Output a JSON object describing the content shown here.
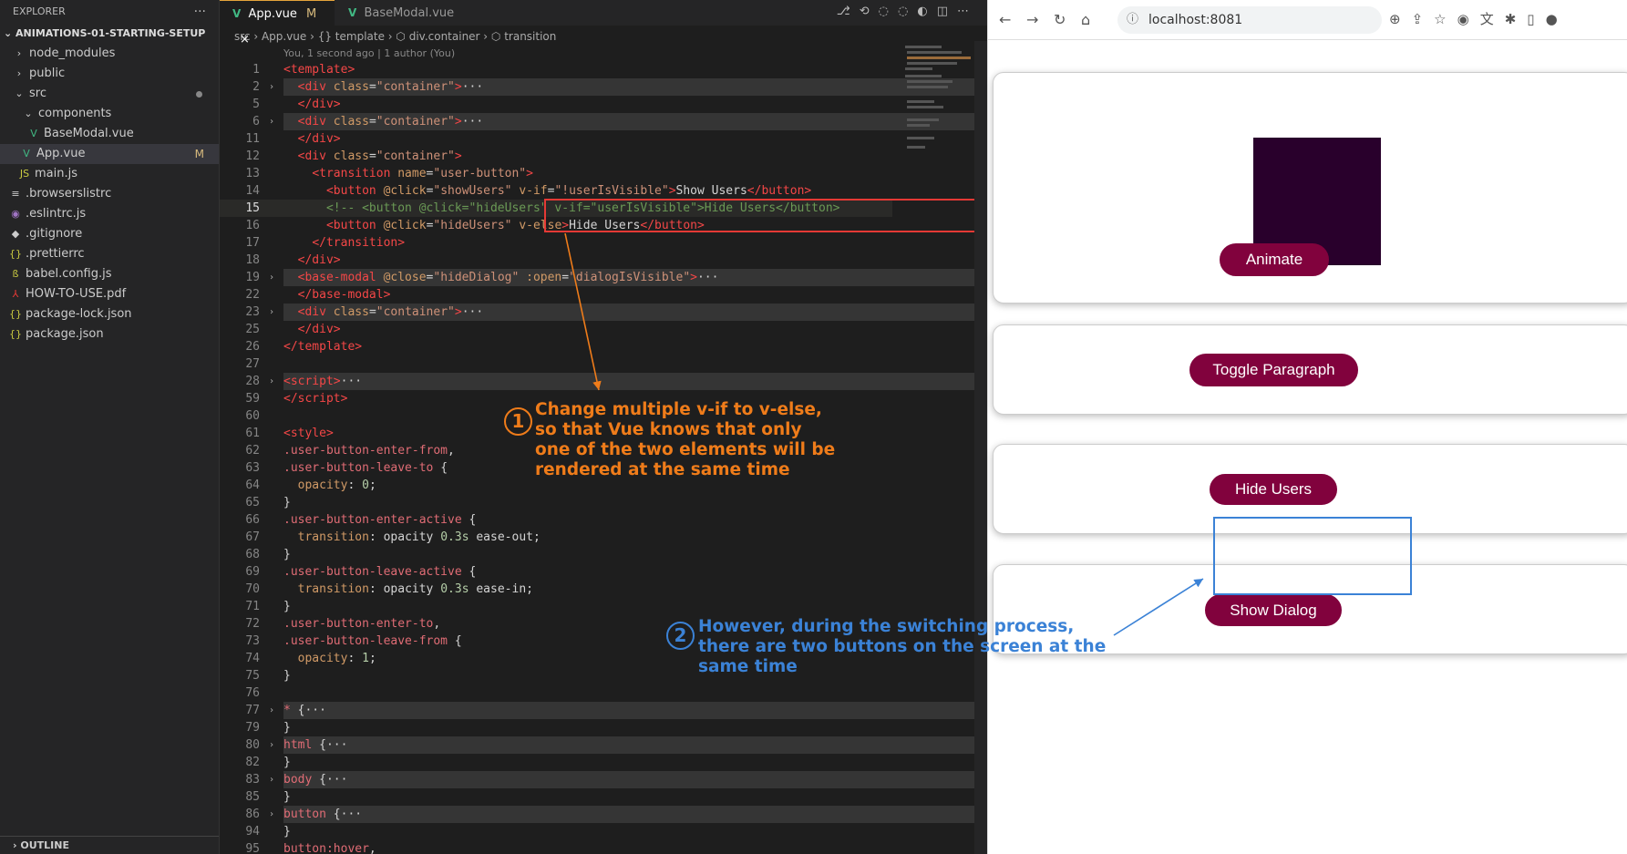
{
  "explorer": {
    "title": "EXPLORER",
    "more": "···",
    "project": "ANIMATIONS-01-STARTING-SETUP",
    "items": [
      {
        "label": "node_modules",
        "icon": "›",
        "indent": 14
      },
      {
        "label": "public",
        "icon": "›",
        "indent": 14
      },
      {
        "label": "src",
        "icon": "⌄",
        "indent": 14
      },
      {
        "label": "components",
        "icon": "⌄",
        "indent": 24
      },
      {
        "label": "BaseModal.vue",
        "icon": "V",
        "indent": 30
      },
      {
        "label": "App.vue",
        "icon": "V",
        "indent": 22,
        "badge": "M"
      },
      {
        "label": "main.js",
        "icon": "JS",
        "indent": 20
      },
      {
        "label": ".browserslistrc",
        "icon": "≡",
        "indent": 10
      },
      {
        "label": ".eslintrc.js",
        "icon": "◉",
        "indent": 10
      },
      {
        "label": ".gitignore",
        "icon": "◆",
        "indent": 10
      },
      {
        "label": ".prettierrc",
        "icon": "{}",
        "indent": 10
      },
      {
        "label": "babel.config.js",
        "icon": "ß",
        "indent": 10
      },
      {
        "label": "HOW-TO-USE.pdf",
        "icon": "⅄",
        "indent": 10
      },
      {
        "label": "package-lock.json",
        "icon": "{}",
        "indent": 10
      },
      {
        "label": "package.json",
        "icon": "{}",
        "indent": 10
      }
    ],
    "outline": "OUTLINE"
  },
  "editor": {
    "tabs": [
      {
        "label": "App.vue",
        "badge": "M",
        "close": "×"
      },
      {
        "label": "BaseModal.vue"
      }
    ],
    "breadcrumb": "src  ›  App.vue  ›  {} template  ›  ⬡ div.container  ›  ⬡ transition",
    "blame": "You, 1 second ago | 1 author (You)",
    "lines": [
      {
        "n": "1",
        "html": "<span class='tg'>&lt;template&gt;</span>"
      },
      {
        "n": "2",
        "fold": true,
        "folded": true,
        "html": "  <span class='tg'>&lt;div</span> <span class='at'>class</span>=<span class='st'>\"container\"</span><span class='tg'>&gt;</span>···"
      },
      {
        "n": "5",
        "html": "  <span class='tg'>&lt;/div&gt;</span>"
      },
      {
        "n": "6",
        "fold": true,
        "folded": true,
        "html": "  <span class='tg'>&lt;div</span> <span class='at'>class</span>=<span class='st'>\"container\"</span><span class='tg'>&gt;</span>···"
      },
      {
        "n": "11",
        "html": "  <span class='tg'>&lt;/div&gt;</span>"
      },
      {
        "n": "12",
        "html": "  <span class='tg'>&lt;div</span> <span class='at'>class</span>=<span class='st'>\"container\"</span><span class='tg'>&gt;</span>"
      },
      {
        "n": "13",
        "html": "    <span class='tg'>&lt;transition</span> <span class='at'>name</span>=<span class='st'>\"user-button\"</span><span class='tg'>&gt;</span>"
      },
      {
        "n": "14",
        "html": "      <span class='tg'>&lt;button</span> <span class='at'>@click</span>=<span class='st'>\"showUsers\"</span> <span class='at'>v-if</span>=<span class='st'>\"!userIsVisible\"</span><span class='tg'>&gt;</span>Show Users<span class='tg'>&lt;/button&gt;</span>"
      },
      {
        "n": "15",
        "cur": true,
        "html": "      <span class='cm'>&lt;!-- &lt;button @click=\"hideUsers\" v-if=\"userIsVisible\"&gt;Hide Users&lt;/button&gt;</span>"
      },
      {
        "n": "16",
        "html": "      <span class='tg'>&lt;button</span> <span class='at'>@click</span>=<span class='st'>\"hideUsers\"</span> <span class='at'>v-else</span><span class='tg'>&gt;</span>Hide Users<span class='tg'>&lt;/button&gt;</span>"
      },
      {
        "n": "17",
        "html": "    <span class='tg'>&lt;/transition&gt;</span>"
      },
      {
        "n": "18",
        "html": "  <span class='tg'>&lt;/div&gt;</span>"
      },
      {
        "n": "19",
        "fold": true,
        "folded": true,
        "html": "  <span class='tg'>&lt;base-modal</span> <span class='at'>@close</span>=<span class='st'>\"hideDialog\"</span> <span class='at'>:open</span>=<span class='st'>\"dialogIsVisible\"</span><span class='tg'>&gt;</span>···"
      },
      {
        "n": "22",
        "html": "  <span class='tg'>&lt;/base-modal&gt;</span>"
      },
      {
        "n": "23",
        "fold": true,
        "folded": true,
        "html": "  <span class='tg'>&lt;div</span> <span class='at'>class</span>=<span class='st'>\"container\"</span><span class='tg'>&gt;</span>···"
      },
      {
        "n": "25",
        "html": "  <span class='tg'>&lt;/div&gt;</span>"
      },
      {
        "n": "26",
        "html": "<span class='tg'>&lt;/template&gt;</span>"
      },
      {
        "n": "27",
        "html": ""
      },
      {
        "n": "28",
        "fold": true,
        "folded": true,
        "html": "<span class='tg'>&lt;script&gt;</span>···"
      },
      {
        "n": "59",
        "html": "<span class='tg'>&lt;/script&gt;</span>"
      },
      {
        "n": "60",
        "html": ""
      },
      {
        "n": "61",
        "html": "<span class='tg'>&lt;style&gt;</span>"
      },
      {
        "n": "62",
        "html": "<span class='sel'>.user-button-enter-from</span>,"
      },
      {
        "n": "63",
        "html": "<span class='sel'>.user-button-leave-to</span> {"
      },
      {
        "n": "64",
        "html": "  <span class='at'>opacity</span>: <span class='num'>0</span>;"
      },
      {
        "n": "65",
        "html": "}"
      },
      {
        "n": "66",
        "html": "<span class='sel'>.user-button-enter-active</span> {"
      },
      {
        "n": "67",
        "html": "  <span class='at'>transition</span>: opacity <span class='num'>0.3s</span> ease-out;"
      },
      {
        "n": "68",
        "html": "}"
      },
      {
        "n": "69",
        "html": "<span class='sel'>.user-button-leave-active</span> {"
      },
      {
        "n": "70",
        "html": "  <span class='at'>transition</span>: opacity <span class='num'>0.3s</span> ease-in;"
      },
      {
        "n": "71",
        "html": "}"
      },
      {
        "n": "72",
        "html": "<span class='sel'>.user-button-enter-to</span>,"
      },
      {
        "n": "73",
        "html": "<span class='sel'>.user-button-leave-from</span> {"
      },
      {
        "n": "74",
        "html": "  <span class='at'>opacity</span>: <span class='num'>1</span>;"
      },
      {
        "n": "75",
        "html": "}"
      },
      {
        "n": "76",
        "html": ""
      },
      {
        "n": "77",
        "fold": true,
        "folded": true,
        "html": "<span class='sel'>*</span> {···"
      },
      {
        "n": "79",
        "html": "}"
      },
      {
        "n": "80",
        "fold": true,
        "folded": true,
        "html": "<span class='sel'>html</span> {···"
      },
      {
        "n": "82",
        "html": "}"
      },
      {
        "n": "83",
        "fold": true,
        "folded": true,
        "html": "<span class='sel'>body</span> {···"
      },
      {
        "n": "85",
        "html": "}"
      },
      {
        "n": "86",
        "fold": true,
        "folded": true,
        "html": "<span class='sel'>button</span> {···"
      },
      {
        "n": "94",
        "html": "}"
      },
      {
        "n": "95",
        "html": "<span class='sel'>button:hover</span>,"
      }
    ]
  },
  "browser": {
    "url": "localhost:8081",
    "buttons": {
      "animate": "Animate",
      "toggle": "Toggle Paragraph",
      "hide_users": "Hide Users",
      "show_dialog": "Show Dialog"
    }
  },
  "annotations": {
    "one": {
      "num": "1",
      "lines": [
        "Change multiple v-if to v-else,",
        "so that Vue knows that only",
        "one of the two elements will be",
        "rendered at the same time"
      ]
    },
    "two": {
      "num": "2",
      "lines": [
        "However, during the switching process,",
        "there are two buttons on the screen at the",
        "same time"
      ]
    }
  },
  "colors": {
    "button_bg": "#81023d",
    "block": "#29002c",
    "annotation_orange": "#ef7c1a",
    "annotation_blue": "#3b82d6"
  }
}
